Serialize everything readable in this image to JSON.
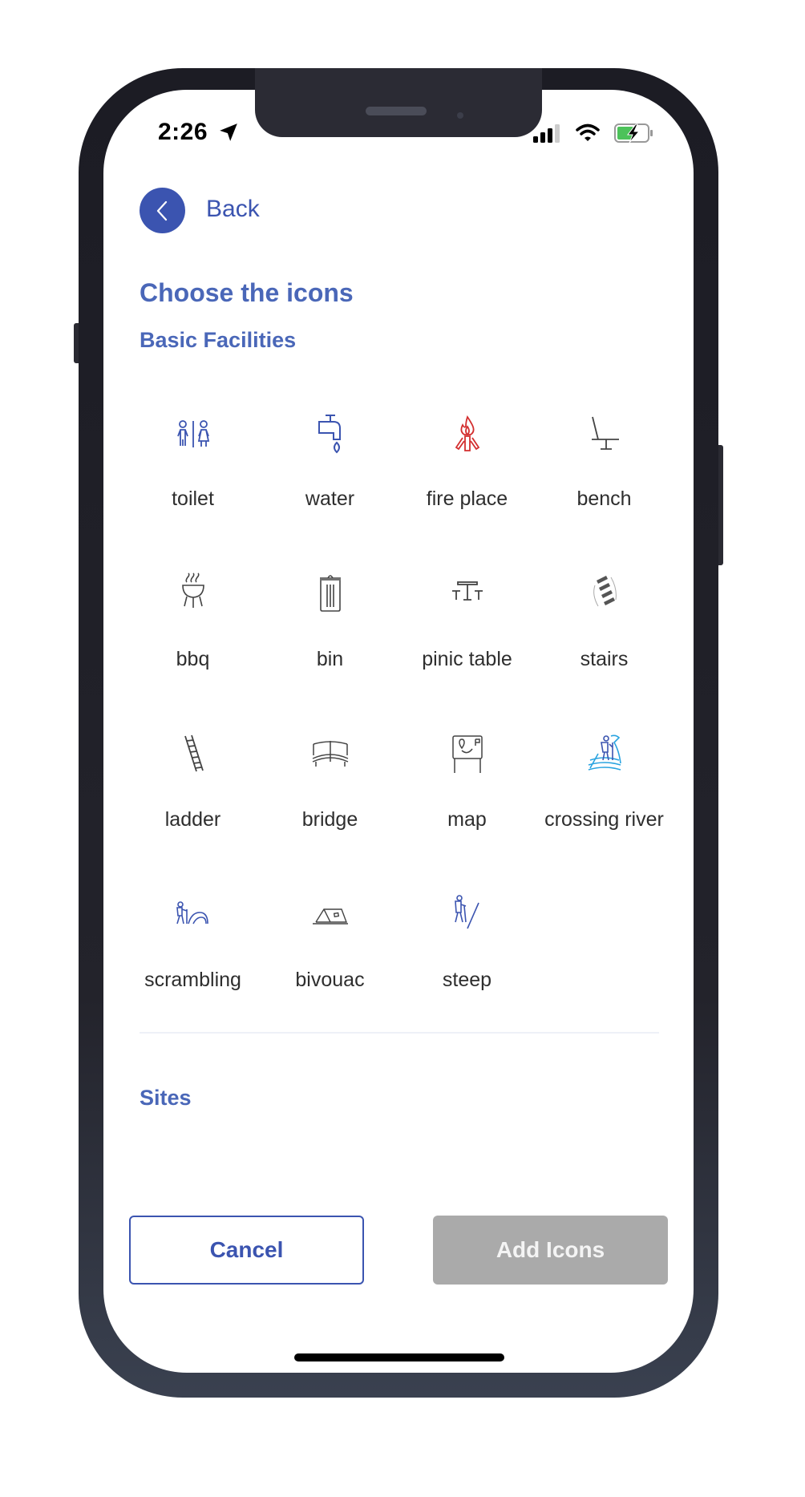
{
  "status_bar": {
    "time": "2:26",
    "icons": [
      "location-arrow-icon",
      "cellular-signal-icon",
      "wifi-icon",
      "battery-charging-icon"
    ]
  },
  "header": {
    "back_icon": "chevron-left-icon",
    "back_label": "Back"
  },
  "page_title": "Choose the icons",
  "sections": [
    {
      "title": "Basic Facilities",
      "items": [
        {
          "label": "toilet",
          "icon": "toilet-icon",
          "color": "#3b54b0"
        },
        {
          "label": "water",
          "icon": "water-tap-icon",
          "color": "#3b54b0"
        },
        {
          "label": "fire place",
          "icon": "campfire-icon",
          "color": "#d32f2f"
        },
        {
          "label": "bench",
          "icon": "bench-icon",
          "color": "#444444"
        },
        {
          "label": "bbq",
          "icon": "bbq-grill-icon",
          "color": "#444444"
        },
        {
          "label": "bin",
          "icon": "trash-bin-icon",
          "color": "#444444"
        },
        {
          "label": "pinic table",
          "icon": "picnic-table-icon",
          "color": "#444444"
        },
        {
          "label": "stairs",
          "icon": "stairs-icon",
          "color": "#555555"
        },
        {
          "label": "ladder",
          "icon": "ladder-icon",
          "color": "#444444"
        },
        {
          "label": "bridge",
          "icon": "bridge-icon",
          "color": "#444444"
        },
        {
          "label": "map",
          "icon": "map-board-icon",
          "color": "#444444"
        },
        {
          "label": "crossing river",
          "icon": "crossing-river-icon",
          "color": "#29a3e0"
        },
        {
          "label": "scrambling",
          "icon": "scrambling-icon",
          "color": "#3b54b0"
        },
        {
          "label": "bivouac",
          "icon": "tent-icon",
          "color": "#444444"
        },
        {
          "label": "steep",
          "icon": "steep-hiker-icon",
          "color": "#3b54b0"
        }
      ]
    },
    {
      "title": "Sites",
      "items": []
    }
  ],
  "footer": {
    "cancel_label": "Cancel",
    "add_label": "Add Icons"
  },
  "colors": {
    "accent": "#3b54b0",
    "heading": "#4a67b8",
    "disabled_button": "#aaaaaa"
  }
}
